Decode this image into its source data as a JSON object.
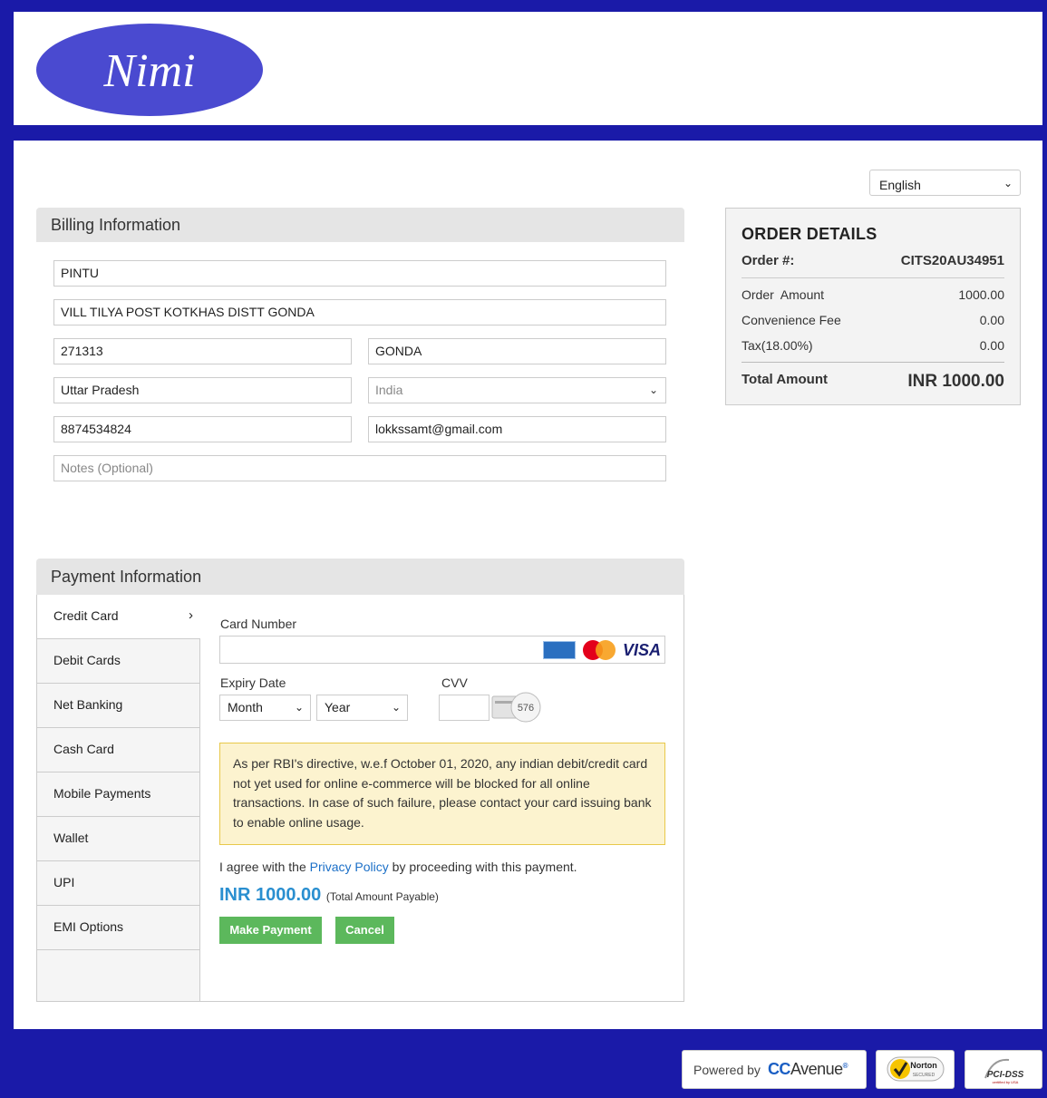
{
  "brand": {
    "logo_text": "Nimi"
  },
  "language": {
    "selected": "English"
  },
  "billing": {
    "heading": "Billing Information",
    "name": "PINTU",
    "address": "VILL TILYA POST KOTKHAS DISTT GONDA",
    "zip": "271313",
    "city": "GONDA",
    "state": "Uttar Pradesh",
    "country": "India",
    "phone": "8874534824",
    "email": "lokkssamt@gmail.com",
    "notes_placeholder": "Notes (Optional)"
  },
  "order": {
    "title": "ORDER DETAILS",
    "order_no_label": "Order #:",
    "order_no": "CITS20AU34951",
    "rows": [
      {
        "label": "Order  Amount",
        "value": "1000.00"
      },
      {
        "label": "Convenience Fee",
        "value": "0.00"
      },
      {
        "label": "Tax(18.00%)",
        "value": "0.00"
      }
    ],
    "total_label": "Total Amount",
    "total_value": "INR 1000.00"
  },
  "payment": {
    "heading": "Payment Information",
    "tabs": [
      "Credit Card",
      "Debit Cards",
      "Net Banking",
      "Cash Card",
      "Mobile Payments",
      "Wallet",
      "UPI",
      "EMI Options"
    ],
    "active_tab": "Credit Card",
    "card_number_label": "Card Number",
    "expiry_label": "Expiry Date",
    "month": "Month",
    "year": "Year",
    "cvv_label": "CVV",
    "cvv_hint": "576",
    "card_brands": [
      "AMERICAN EXPRESS",
      "MasterCard",
      "VISA"
    ],
    "notice": "As per RBI's directive, w.e.f October 01, 2020, any indian debit/credit card not yet used for online e-commerce will be blocked for all online transactions. In case of such failure, please contact your card issuing bank to enable online usage.",
    "agree_prefix": "I agree with the ",
    "privacy_link": "Privacy Policy",
    "agree_suffix": " by proceeding with this payment.",
    "amount": "INR 1000.00",
    "amount_note": "(Total Amount Payable)",
    "pay_button": "Make Payment",
    "cancel_button": "Cancel"
  },
  "footer": {
    "powered_by": "Powered by",
    "cc_brand": "CC",
    "cc_brand_rest": "Avenue",
    "cc_reg": "®",
    "norton": "Norton",
    "norton_sub": "SECURED",
    "pci": "PCI-DSS",
    "pci_sub": "certified by USA"
  },
  "colors": {
    "frame": "#1a1aa8",
    "accent_green": "#5cb85c",
    "link": "#1b6fc7",
    "amount": "#2a8fd0"
  }
}
